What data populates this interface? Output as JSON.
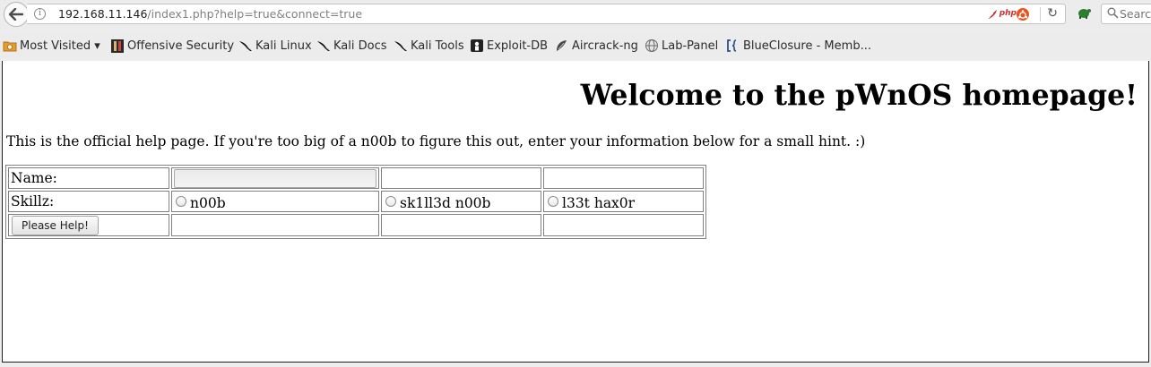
{
  "browser": {
    "url_host": "192.168.11.146",
    "url_path": "/index1.php?help=true&connect=true",
    "php_badge": "php",
    "search_placeholder": "Search",
    "colors": {
      "ubuntu_orange": "#e95420",
      "php_red": "#d03030"
    }
  },
  "bookmarks": [
    {
      "label": "Most Visited ▾",
      "icon": "most-visited-icon"
    },
    {
      "label": "Offensive Security",
      "icon": "offsec-icon"
    },
    {
      "label": "Kali Linux",
      "icon": "kali-dragon-icon"
    },
    {
      "label": "Kali Docs",
      "icon": "kali-dragon-icon"
    },
    {
      "label": "Kali Tools",
      "icon": "kali-dragon-icon"
    },
    {
      "label": "Exploit-DB",
      "icon": "exploit-db-icon"
    },
    {
      "label": "Aircrack-ng",
      "icon": "aircrack-icon"
    },
    {
      "label": "Lab-Panel",
      "icon": "globe-icon"
    },
    {
      "label": "BlueClosure - Memb...",
      "icon": "blueclosure-icon"
    }
  ],
  "page": {
    "heading": "Welcome to the pWnOS homepage!",
    "intro": "This is the official help page. If you're too big of a n00b to figure this out, enter your information below for a small hint. :)",
    "form": {
      "name_label": "Name:",
      "name_value": "",
      "skill_label": "Skillz:",
      "skills": [
        "n00b",
        "sk1ll3d n00b",
        "l33t hax0r"
      ],
      "submit_label": "Please Help!"
    }
  }
}
